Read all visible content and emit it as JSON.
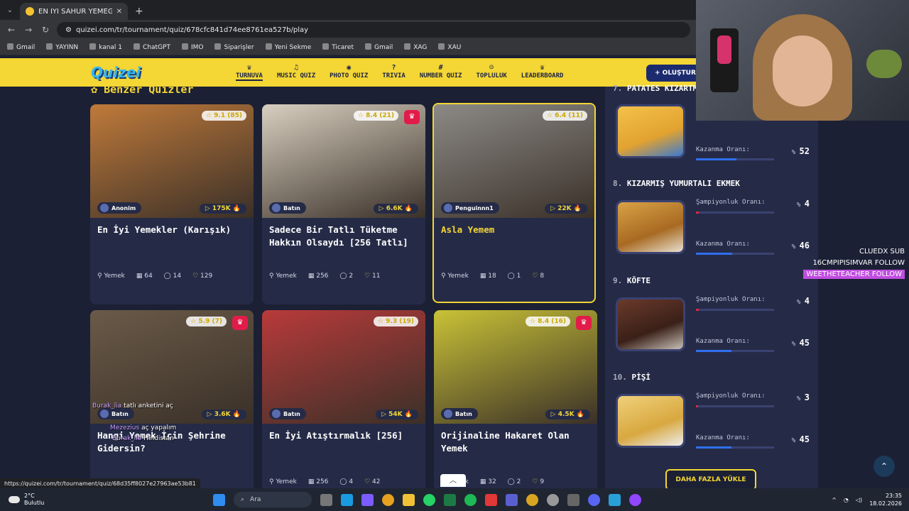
{
  "browser": {
    "tab_title": "EN İYİ SAHUR YEMEĞİ - Tier Lis",
    "url": "quizei.com/tr/tournament/quiz/678cfc841d74ee8761ea527b/play",
    "bookmarks": [
      "Gmail",
      "YAYINN",
      "kanal 1",
      "ChatGPT",
      "IMO",
      "Siparişler",
      "Yeni Sekme",
      "Ticaret",
      "Gmail",
      "XAG",
      "XAU"
    ],
    "status_url": "https://quizei.com/tr/tournament/quiz/68d35ff8027e27963ae53b81"
  },
  "site": {
    "logo": "Quizei",
    "nav": [
      "TURNUVA",
      "MUSIC QUIZ",
      "PHOTO QUIZ",
      "TRIVIA",
      "NUMBER QUIZ",
      "TOPLULUK",
      "LEADERBOARD"
    ],
    "create_label": "+ OLUŞTUR",
    "section_title": "Benzer Quizler"
  },
  "cards": [
    {
      "rating": "9.1",
      "votes": "(85)",
      "crown": false,
      "author": "Anonim",
      "plays": "175K",
      "title": "En İyi Yemekler (Karışık)",
      "category": "Yemek",
      "items": "64",
      "comments": "14",
      "likes": "129",
      "img": "#c07a3a"
    },
    {
      "rating": "8.4",
      "votes": "(21)",
      "crown": true,
      "author": "Batın",
      "plays": "6.6K",
      "title": "Sadece Bir Tatlı Tüketme Hakkın Olsaydı [256 Tatlı]",
      "category": "Yemek",
      "items": "256",
      "comments": "2",
      "likes": "11",
      "img": "#d8cfc0"
    },
    {
      "rating": "6.4",
      "votes": "(11)",
      "crown": false,
      "author": "Penguinnn1",
      "plays": "22K",
      "title": "Asla Yemem",
      "category": "Yemek",
      "items": "18",
      "comments": "1",
      "likes": "8",
      "img": "#8c8a86"
    },
    {
      "rating": "5.9",
      "votes": "(7)",
      "crown": true,
      "author": "Batın",
      "plays": "3.6K",
      "title": "Hangi Yemek İçin Şehrine Gidersin?",
      "category": "",
      "items": "",
      "comments": "4",
      "likes": "1",
      "img": "#6a5a48"
    },
    {
      "rating": "9.3",
      "votes": "(19)",
      "crown": false,
      "author": "Batın",
      "plays": "54K",
      "title": "En İyi Atıştırmalık [256]",
      "category": "Yemek",
      "items": "256",
      "comments": "4",
      "likes": "42",
      "img": "#b83a3a"
    },
    {
      "rating": "8.4",
      "votes": "(16)",
      "crown": true,
      "author": "Batın",
      "plays": "4.5K",
      "title": "Orijinaline Hakaret Olan Yemek",
      "category": "Yemek",
      "items": "32",
      "comments": "2",
      "likes": "9",
      "img": "#c9c236"
    }
  ],
  "ranking": {
    "top_partial": {
      "rank": "7.",
      "name": "PATATES KIZARTMASI",
      "win_label": "Kazanma Oranı:",
      "win": "52"
    },
    "items": [
      {
        "rank": "8.",
        "name": "KIZARMIŞ YUMURTALI EKMEK",
        "champ_label": "Şampiyonluk Oranı:",
        "champ": "4",
        "win_label": "Kazanma Oranı:",
        "win": "46"
      },
      {
        "rank": "9.",
        "name": "KÖFTE",
        "champ_label": "Şampiyonluk Oranı:",
        "champ": "4",
        "win_label": "Kazanma Oranı:",
        "win": "45"
      },
      {
        "rank": "10.",
        "name": "PİŞİ",
        "champ_label": "Şampiyonluk Oranı:",
        "champ": "3",
        "win_label": "Kazanma Oranı:",
        "win": "45"
      }
    ],
    "load_more": "DAHA FAZLA YÜKLE"
  },
  "stream": {
    "overlay": [
      "CLUEDX SUB",
      "16CMPIPISIMVAR FOLLOW",
      "WEETHETEACHER FOLLOW"
    ],
    "chat": [
      {
        "user": "Burak_lia",
        "msg": "tatlı anketini aç"
      },
      {
        "user": "Mezezius",
        "msg": "aç yapalım"
      },
      {
        "user": "Burak_lia",
        "msg": "Hindistan"
      }
    ]
  },
  "taskbar": {
    "weather_temp": "2°C",
    "weather_desc": "Bulutlu",
    "search": "Ara",
    "time": "23:35",
    "date": "18.02.2026"
  }
}
